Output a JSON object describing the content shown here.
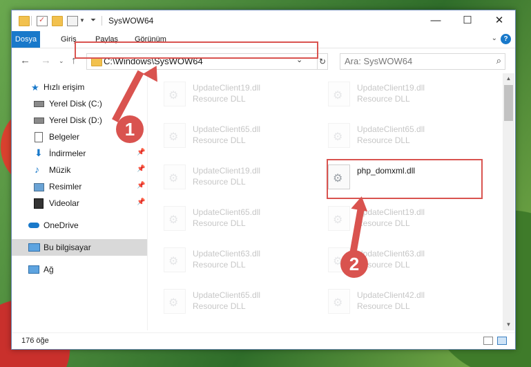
{
  "window": {
    "title": "SysWOW64",
    "controls": {
      "minimize": "—",
      "maximize": "☐",
      "close": "✕"
    }
  },
  "ribbon": {
    "tabs": [
      "Dosya",
      "Giriş",
      "Paylaş",
      "Görünüm"
    ],
    "help": "?"
  },
  "nav": {
    "address": "C:\\Windows\\SysWOW64",
    "search_placeholder": "Ara: SysWOW64"
  },
  "sidebar": {
    "items": [
      {
        "label": "Hızlı erişim",
        "icon": "star-icon"
      },
      {
        "label": "Yerel Disk (C:)",
        "icon": "drive-icon"
      },
      {
        "label": "Yerel Disk (D:)",
        "icon": "drive-icon"
      },
      {
        "label": "Belgeler",
        "icon": "documents-icon"
      },
      {
        "label": "İndirmeler",
        "icon": "download-icon"
      },
      {
        "label": "Müzik",
        "icon": "music-icon"
      },
      {
        "label": "Resimler",
        "icon": "pictures-icon"
      },
      {
        "label": "Videolar",
        "icon": "videos-icon"
      },
      {
        "label": "OneDrive",
        "icon": "cloud-icon"
      },
      {
        "label": "Bu bilgisayar",
        "icon": "computer-icon"
      },
      {
        "label": "Ağ",
        "icon": "network-icon"
      }
    ]
  },
  "files": {
    "left": [
      {
        "name": "UpdateClient19.dll",
        "type": "Resource DLL"
      },
      {
        "name": "UpdateClient65.dll",
        "type": "Resource DLL"
      },
      {
        "name": "UpdateClient19.dll",
        "type": "Resource DLL"
      },
      {
        "name": "UpdateClient65.dll",
        "type": "Resource DLL"
      },
      {
        "name": "UpdateClient63.dll",
        "type": "Resource DLL"
      },
      {
        "name": "UpdateClient65.dll",
        "type": "Resource DLL"
      }
    ],
    "right": [
      {
        "name": "UpdateClient19.dll",
        "type": "Resource DLL"
      },
      {
        "name": "UpdateClient65.dll",
        "type": "Resource DLL"
      },
      {
        "name": "php_domxml.dll",
        "type": ""
      },
      {
        "name": "UpdateClient19.dll",
        "type": "Resource DLL"
      },
      {
        "name": "UpdateClient63.dll",
        "type": "Resource DLL"
      },
      {
        "name": "UpdateClient42.dll",
        "type": "Resource DLL"
      }
    ]
  },
  "status": {
    "count": "176 öğe"
  },
  "annotations": {
    "step1": "1",
    "step2": "2"
  },
  "colors": {
    "accent": "#1979ca",
    "highlight": "#d9534f"
  }
}
